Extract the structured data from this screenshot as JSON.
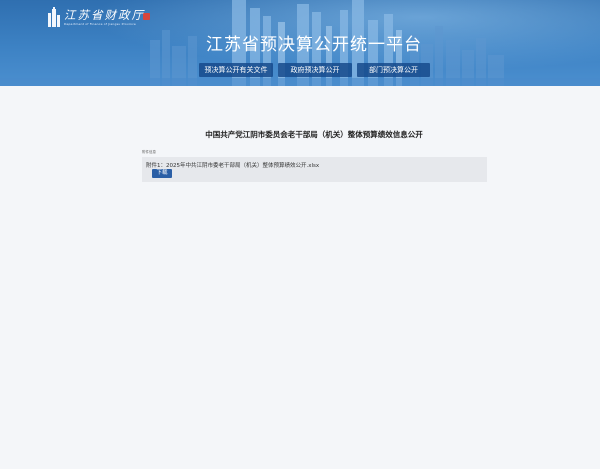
{
  "header": {
    "logo_name": "江苏省财政厅",
    "logo_name_en": "Department of Finance of Jiangsu Province",
    "site_title": "江苏省预决算公开统一平台",
    "nav": [
      {
        "label": "预决算公开有关文件"
      },
      {
        "label": "政府预决算公开"
      },
      {
        "label": "部门预决算公开"
      }
    ]
  },
  "main": {
    "page_title": "中国共产党江阴市委员会老干部局（机关）整体预算绩效信息公开",
    "section_label": "附件信息",
    "attachment": {
      "text": "附件1：2025年中共江阴市委老干部局（机关）整体预算绩效公开.xlsx",
      "download_label": "下载"
    }
  },
  "colors": {
    "banner_blue": "#3d82c4",
    "nav_bg": "#164a8c",
    "button_blue": "#2b5fa6",
    "page_bg": "#f4f6f9"
  }
}
